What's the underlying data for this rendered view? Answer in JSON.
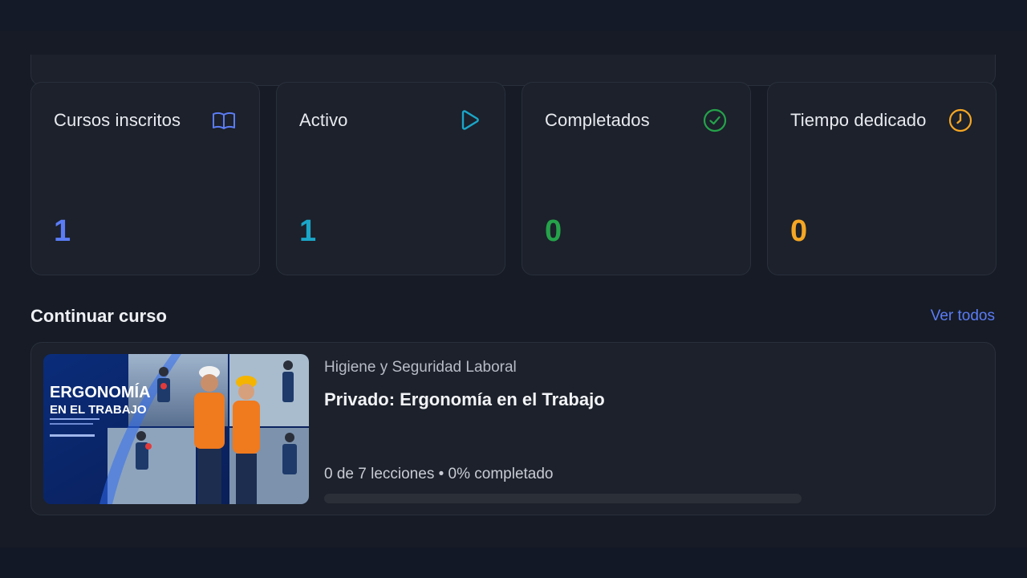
{
  "stats": [
    {
      "label": "Cursos inscritos",
      "value": "1",
      "icon": "book-open-icon",
      "color": "#5b7cf5"
    },
    {
      "label": "Activo",
      "value": "1",
      "icon": "play-icon",
      "color": "#1aa6c8"
    },
    {
      "label": "Completados",
      "value": "0",
      "icon": "check-circle-icon",
      "color": "#25a24a"
    },
    {
      "label": "Tiempo dedicado",
      "value": "0",
      "icon": "clock-icon",
      "color": "#f5a623"
    }
  ],
  "continue_section": {
    "title": "Continuar curso",
    "see_all_label": "Ver todos"
  },
  "course": {
    "category": "Higiene y Seguridad Laboral",
    "title": "Privado: Ergonomía en el Trabajo",
    "progress_text": "0 de 7 lecciones • 0% completado",
    "progress_fraction": 0,
    "thumbnail": {
      "title_line1": "ERGONOMÍA",
      "title_line2": "EN EL TRABAJO"
    }
  }
}
